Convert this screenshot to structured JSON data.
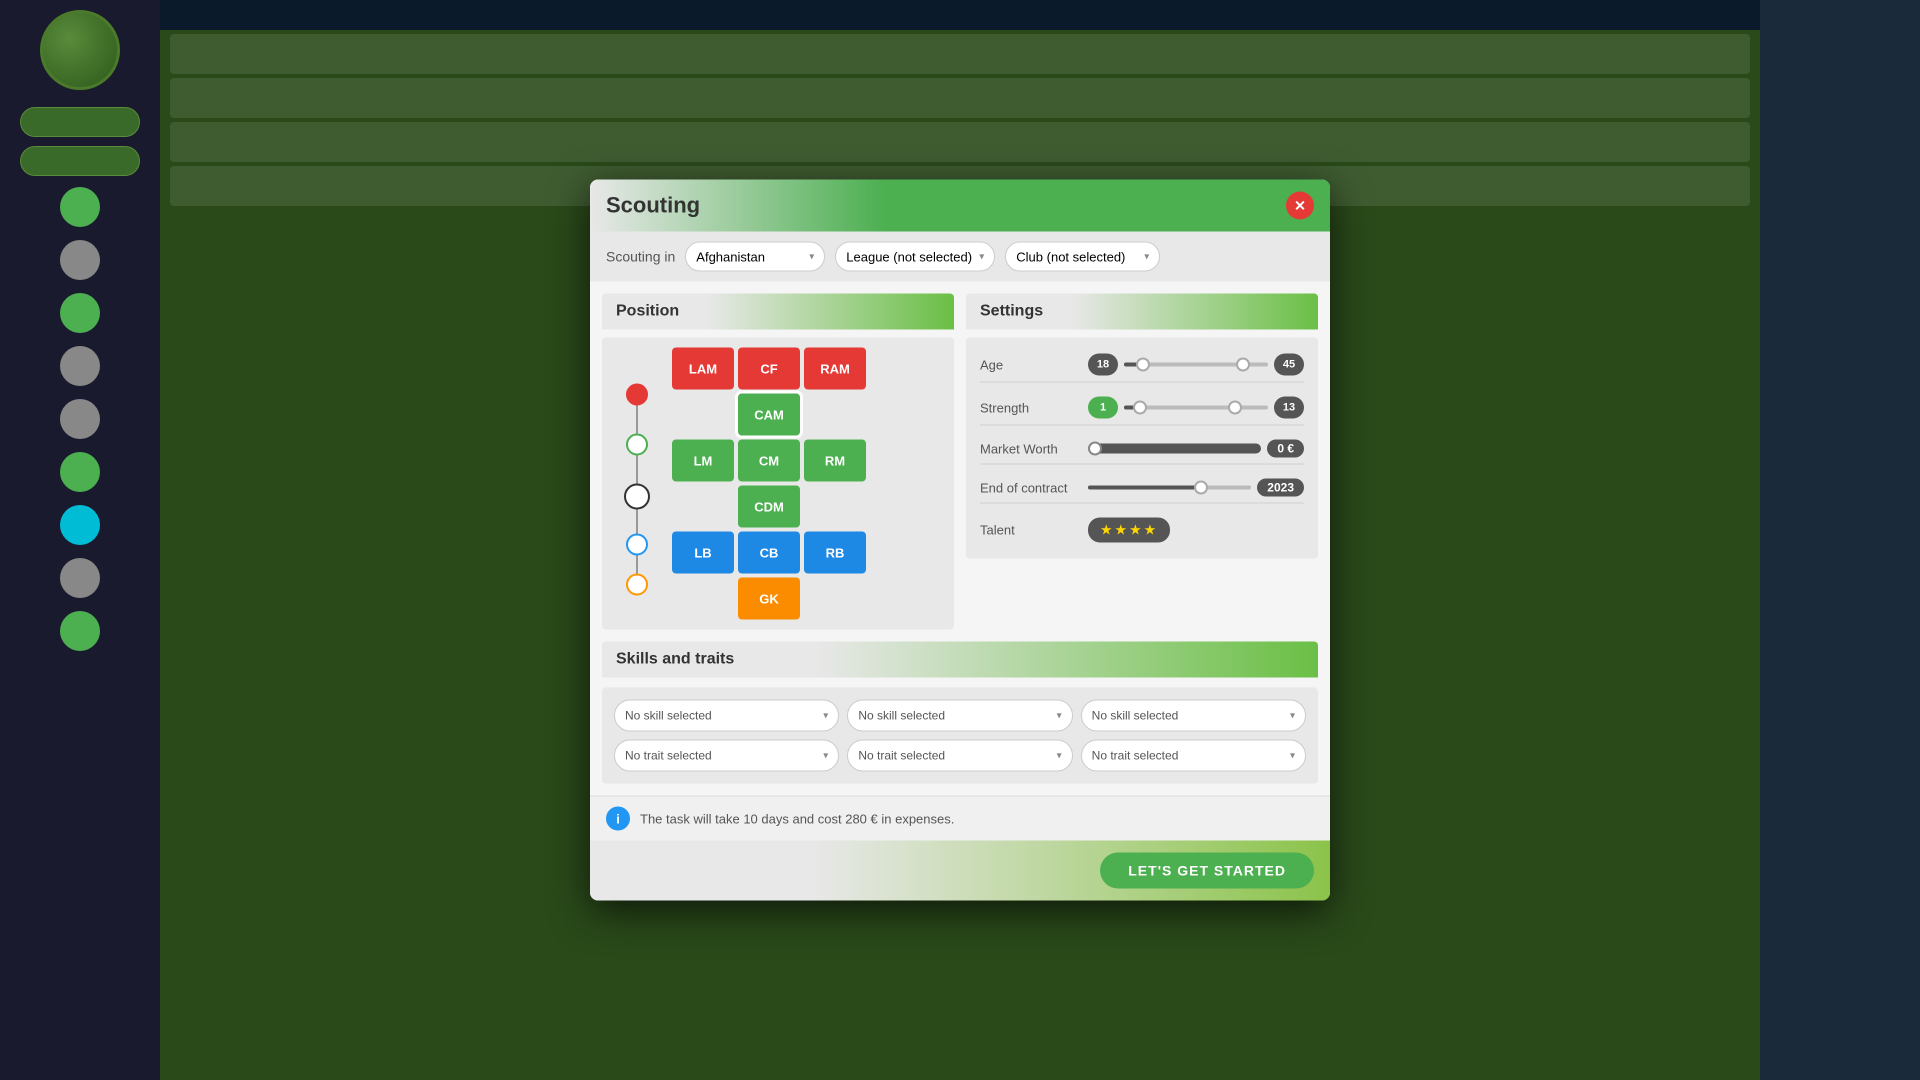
{
  "modal": {
    "title": "Scouting",
    "close_label": "✕",
    "scouting_in_label": "Scouting in",
    "country_dropdown": "Afghanistan",
    "league_dropdown": "League (not selected)",
    "club_dropdown": "Club (not selected)",
    "position_panel": {
      "title": "Position",
      "positions": [
        {
          "id": "LAM",
          "label": "LAM",
          "color": "red",
          "col": 1,
          "row": 1
        },
        {
          "id": "CF",
          "label": "CF",
          "color": "red",
          "col": 2,
          "row": 1
        },
        {
          "id": "RAM",
          "label": "RAM",
          "color": "red",
          "col": 3,
          "row": 1
        },
        {
          "id": "CAM",
          "label": "CAM",
          "color": "green",
          "col": 2,
          "row": 2,
          "selected": true
        },
        {
          "id": "LM",
          "label": "LM",
          "color": "green",
          "col": 1,
          "row": 3
        },
        {
          "id": "CM",
          "label": "CM",
          "color": "green",
          "col": 2,
          "row": 3
        },
        {
          "id": "RM",
          "label": "RM",
          "color": "green",
          "col": 3,
          "row": 3
        },
        {
          "id": "CDM",
          "label": "CDM",
          "color": "green",
          "col": 2,
          "row": 4
        },
        {
          "id": "LB",
          "label": "LB",
          "color": "blue",
          "col": 1,
          "row": 5
        },
        {
          "id": "CB",
          "label": "CB",
          "color": "blue",
          "col": 2,
          "row": 5
        },
        {
          "id": "RB",
          "label": "RB",
          "color": "blue",
          "col": 3,
          "row": 5
        },
        {
          "id": "GK",
          "label": "GK",
          "color": "orange",
          "col": 2,
          "row": 6
        }
      ]
    },
    "settings_panel": {
      "title": "Settings",
      "age": {
        "label": "Age",
        "min": "18",
        "max": "45",
        "min_pos": 10,
        "max_pos": 80
      },
      "strength": {
        "label": "Strength",
        "min": "1",
        "max": "13",
        "min_pos": 10,
        "max_pos": 75
      },
      "market_worth": {
        "label": "Market Worth",
        "value": "0 €"
      },
      "end_of_contract": {
        "label": "End of contract",
        "value": "2023"
      },
      "talent": {
        "label": "Talent",
        "stars": "★★★★"
      }
    },
    "skills_section": {
      "title": "Skills and traits",
      "columns": [
        {
          "skill_placeholder": "No skill selected",
          "trait_placeholder": "No trait selected"
        },
        {
          "skill_placeholder": "No skill selected",
          "trait_placeholder": "No trait selected"
        },
        {
          "skill_placeholder": "No skill selected",
          "trait_placeholder": "No trait selected"
        }
      ]
    },
    "info_text": "The task will take 10 days and cost 280 € in expenses.",
    "start_button": "LET'S GET STARTED"
  }
}
